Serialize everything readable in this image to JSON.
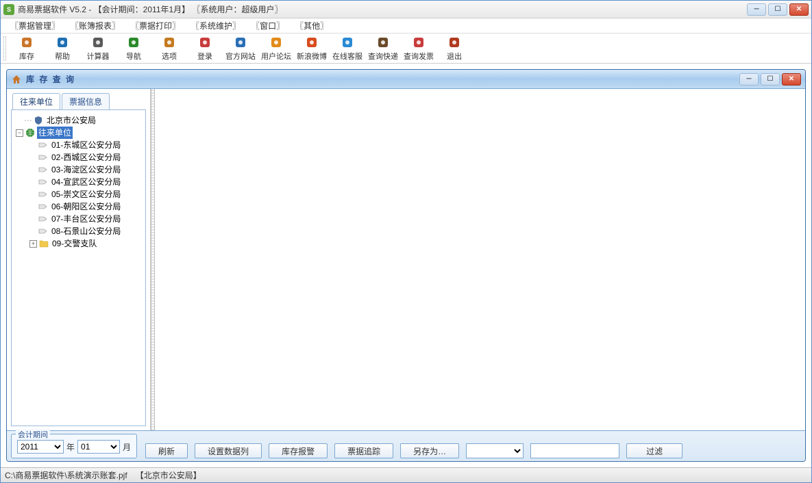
{
  "outer": {
    "title": "商易票据软件 V5.2 - 【会计期间：2011年1月】 〖系统用户：超级用户〗"
  },
  "menu": {
    "items": [
      "〖票据管理〗",
      "〖账簿报表〗",
      "〖票据打印〗",
      "〖系统维护〗",
      "〖窗口〗",
      "〖其他〗"
    ]
  },
  "toolbar": {
    "items": [
      {
        "label": "库存",
        "icon": "home-icon",
        "color": "#c9752a"
      },
      {
        "label": "帮助",
        "icon": "help-icon",
        "color": "#1f6fb2"
      },
      {
        "label": "计算器",
        "icon": "calc-icon",
        "color": "#5a5a5a"
      },
      {
        "label": "导航",
        "icon": "nav-icon",
        "color": "#2a8a2a"
      },
      {
        "label": "选项",
        "icon": "options-icon",
        "color": "#c47a1e"
      },
      {
        "label": "登录",
        "icon": "login-icon",
        "color": "#c93c3c"
      },
      {
        "label": "官方网站",
        "icon": "web-icon",
        "color": "#2a6fb5"
      },
      {
        "label": "用户论坛",
        "icon": "forum-icon",
        "color": "#e28a1a"
      },
      {
        "label": "新浪微博",
        "icon": "weibo-icon",
        "color": "#d84c1e"
      },
      {
        "label": "在线客服",
        "icon": "qq-icon",
        "color": "#2a8ad4"
      },
      {
        "label": "查询快递",
        "icon": "express-icon",
        "color": "#6a4a2a"
      },
      {
        "label": "查询发票",
        "icon": "invoice-icon",
        "color": "#c93c3c"
      },
      {
        "label": "退出",
        "icon": "exit-icon",
        "color": "#b03a1e"
      }
    ]
  },
  "inner": {
    "title": "库 存 查 询",
    "tabs": [
      "往来单位",
      "票据信息"
    ]
  },
  "tree": {
    "root": "北京市公安局",
    "group": "往来单位",
    "children": [
      "01-东城区公安分局",
      "02-西城区公安分局",
      "03-海淀区公安分局",
      "04-宣武区公安分局",
      "05-崇文区公安分局",
      "06-朝阳区公安分局",
      "07-丰台区公安分局",
      "08-石景山公安分局"
    ],
    "folder": "09-交警支队"
  },
  "period": {
    "legend": "会计期间",
    "year": "2011",
    "year_unit": "年",
    "month": "01",
    "month_unit": "月"
  },
  "buttons": {
    "refresh": "刷新",
    "columns": "设置数据列",
    "report": "库存报警",
    "trace": "票据追踪",
    "saveas": "另存为…",
    "filter": "过滤"
  },
  "status": {
    "path": "C:\\商易票据软件\\系统演示账套.pjf",
    "org": "【北京市公安局】"
  }
}
